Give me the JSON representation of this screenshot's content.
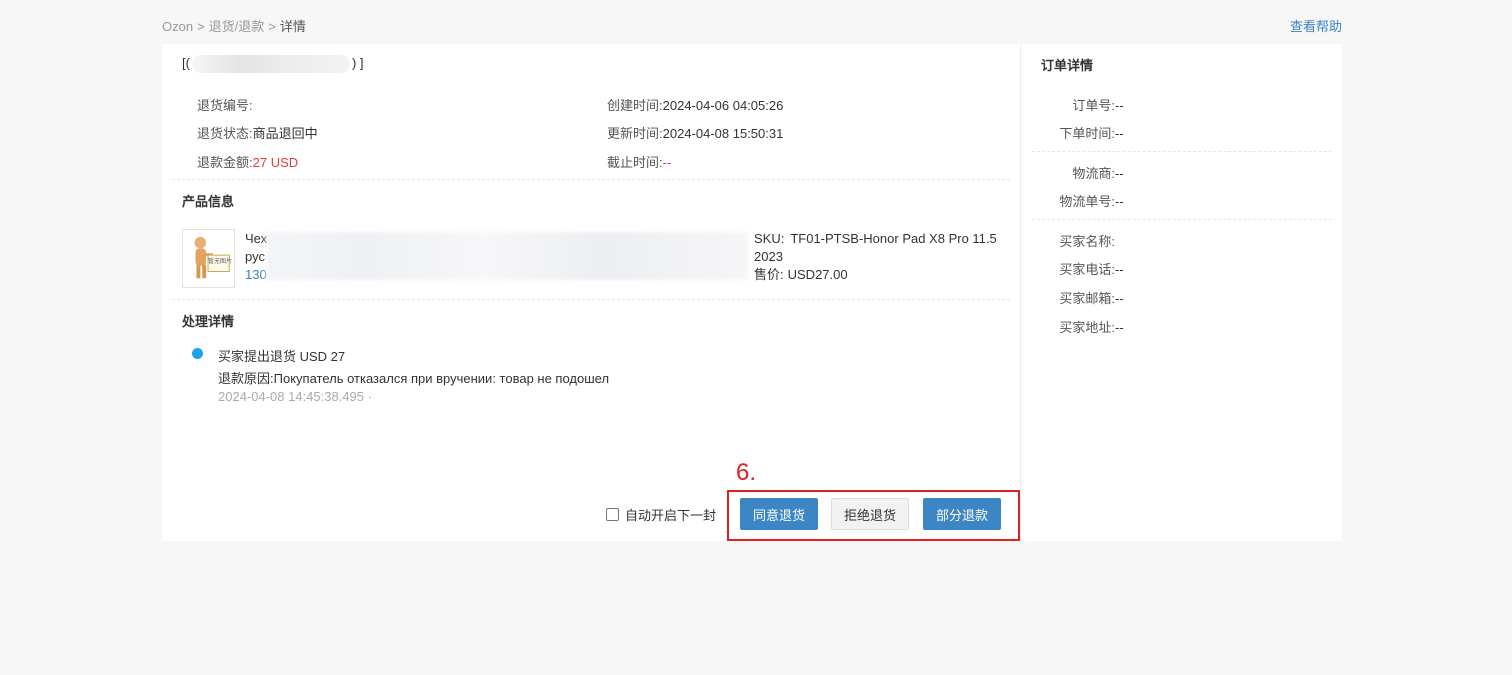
{
  "breadcrumb": {
    "root": "Ozon",
    "sep": ">",
    "middle": "退货/退款",
    "current": "详情"
  },
  "help_link": "查看帮助",
  "order": {
    "prefix": "[(",
    "suffix": ")  ]"
  },
  "return_info": {
    "return_no_label": "退货编号:",
    "return_no": "",
    "status_label": "退货状态:",
    "status": "商品退回中",
    "amount_label": "退款金额:",
    "amount": "27 USD",
    "created_label": "创建时间:",
    "created": "2024-04-06 04:05:26",
    "updated_label": "更新时间:",
    "updated": "2024-04-08 15:50:31",
    "deadline_label": "截止时间:",
    "deadline": "--"
  },
  "product": {
    "section_title": "产品信息",
    "thumb_text": "暂无图片",
    "name_line1": "Чех",
    "name_line2": "рус",
    "name_line3": "130",
    "sku_label": "SKU:",
    "sku": "TF01-PTSB-Honor Pad X8 Pro 11.5 2023",
    "price_label": "售价:",
    "price": "USD27.00"
  },
  "process": {
    "section_title": "处理详情",
    "event_title": "买家提出退货 USD 27",
    "reason_label": "退款原因:",
    "reason": "Покупатель отказался при вручении: товар не подошел",
    "event_time": "2024-04-08 14:45:38.495 ·"
  },
  "annotation": {
    "number": "6."
  },
  "actions": {
    "auto_next_label": "自动开启下一封",
    "agree": "同意退货",
    "reject": "拒绝退货",
    "partial": "部分退款"
  },
  "sidebar": {
    "title": "订单详情",
    "order_no_label": "订单号:",
    "order_no": "--",
    "order_time_label": "下单时间:",
    "order_time": "--",
    "carrier_label": "物流商:",
    "carrier": "--",
    "tracking_label": "物流单号:",
    "tracking": "--",
    "buyer_name_label": "买家名称:",
    "buyer_name": "",
    "buyer_phone_label": "买家电话:",
    "buyer_phone": "--",
    "buyer_email_label": "买家邮箱:",
    "buyer_email": "--",
    "buyer_address_label": "买家地址:",
    "buyer_address": "--"
  },
  "colors": {
    "accent": "#3d86c6",
    "link": "#3b82c4",
    "price_red": "#e4393c",
    "annotation_red": "#e02020",
    "dot": "#1aa3e8"
  }
}
